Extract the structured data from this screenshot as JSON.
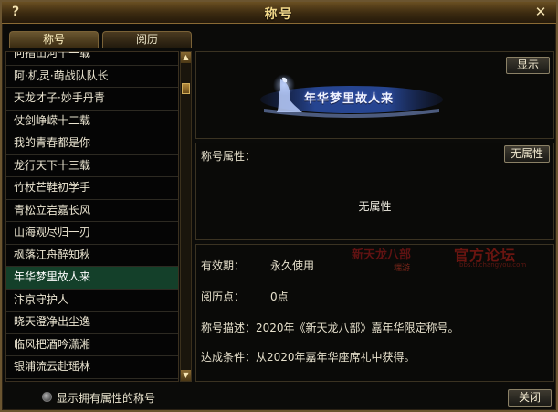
{
  "window": {
    "title": "称号",
    "help_label": "?",
    "close_label": "✕"
  },
  "tabs": [
    {
      "label": "称号"
    },
    {
      "label": "阅历"
    }
  ],
  "title_list": {
    "items": [
      "问指山河十一载",
      "阿·机灵·萌战队队长",
      "天龙才子·妙手丹青",
      "仗剑峥嵘十二载",
      "我的青春都是你",
      "龙行天下十三载",
      "竹杖芒鞋初学手",
      "青松立岩嘉长风",
      "山海观尽归一刃",
      "枫落江舟醉知秋",
      "年华梦里故人来",
      "汴京守护人",
      "晓天澄净出尘逸",
      "临风把酒吟潇湘",
      "银浦流云赴瑶林"
    ],
    "selected_index": 10
  },
  "scrollbar": {
    "up_label": "▲",
    "down_label": "▼"
  },
  "banner": {
    "show_button": "显示",
    "title_text": "年华梦里故人来"
  },
  "attributes": {
    "label": "称号属性：",
    "button": "无属性",
    "value": "无属性"
  },
  "info": {
    "validity_label": "有效期：",
    "validity_value": "永久使用",
    "exp_label": "阅历点：",
    "exp_value": "0点",
    "desc_label": "称号描述：",
    "desc_value": "2020年《新天龙八部》嘉年华限定称号。",
    "cond_label": "达成条件：",
    "cond_value": "从2020年嘉年华座席礼中获得。"
  },
  "watermark": {
    "left": "新天龙八部",
    "left_sub": "端游",
    "right": "官方论坛",
    "url": "bbs.tl.changyou.com"
  },
  "footer": {
    "checkbox_label": "显示拥有属性的称号",
    "close_button": "关闭"
  }
}
